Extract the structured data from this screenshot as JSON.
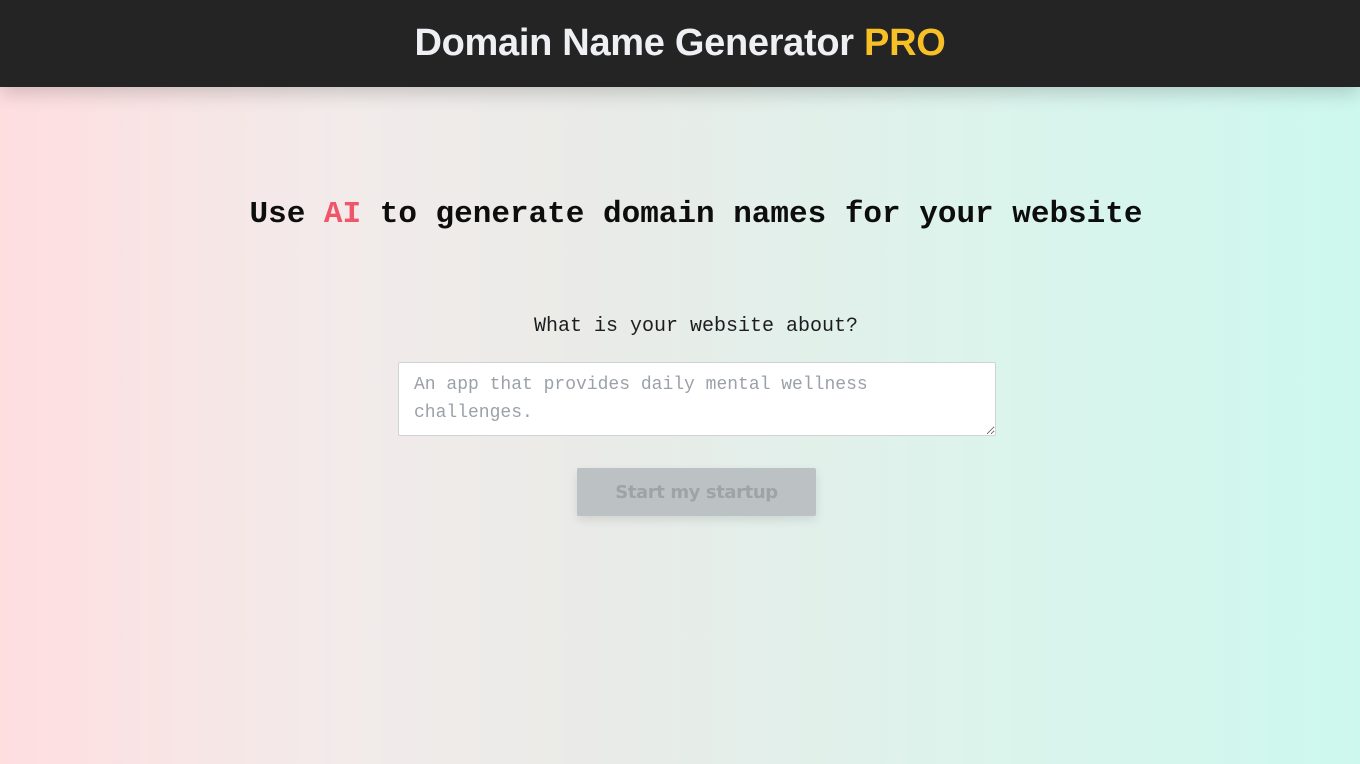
{
  "header": {
    "title_main": "Domain Name Generator",
    "title_accent": "PRO"
  },
  "hero": {
    "headline_before": "Use",
    "headline_accent": "AI",
    "headline_after": "to generate domain names for your website"
  },
  "form": {
    "question_label": "What is your website about?",
    "description_input": {
      "value": "",
      "placeholder": "An app that provides daily mental wellness challenges."
    },
    "submit_label": "Start my startup",
    "submit_disabled": true
  },
  "colors": {
    "header_bg": "#242424",
    "brand_accent": "#f6c026",
    "ai_accent": "#f0566a",
    "gradient_left": "#ffdee0",
    "gradient_right": "#cdf8ee"
  }
}
